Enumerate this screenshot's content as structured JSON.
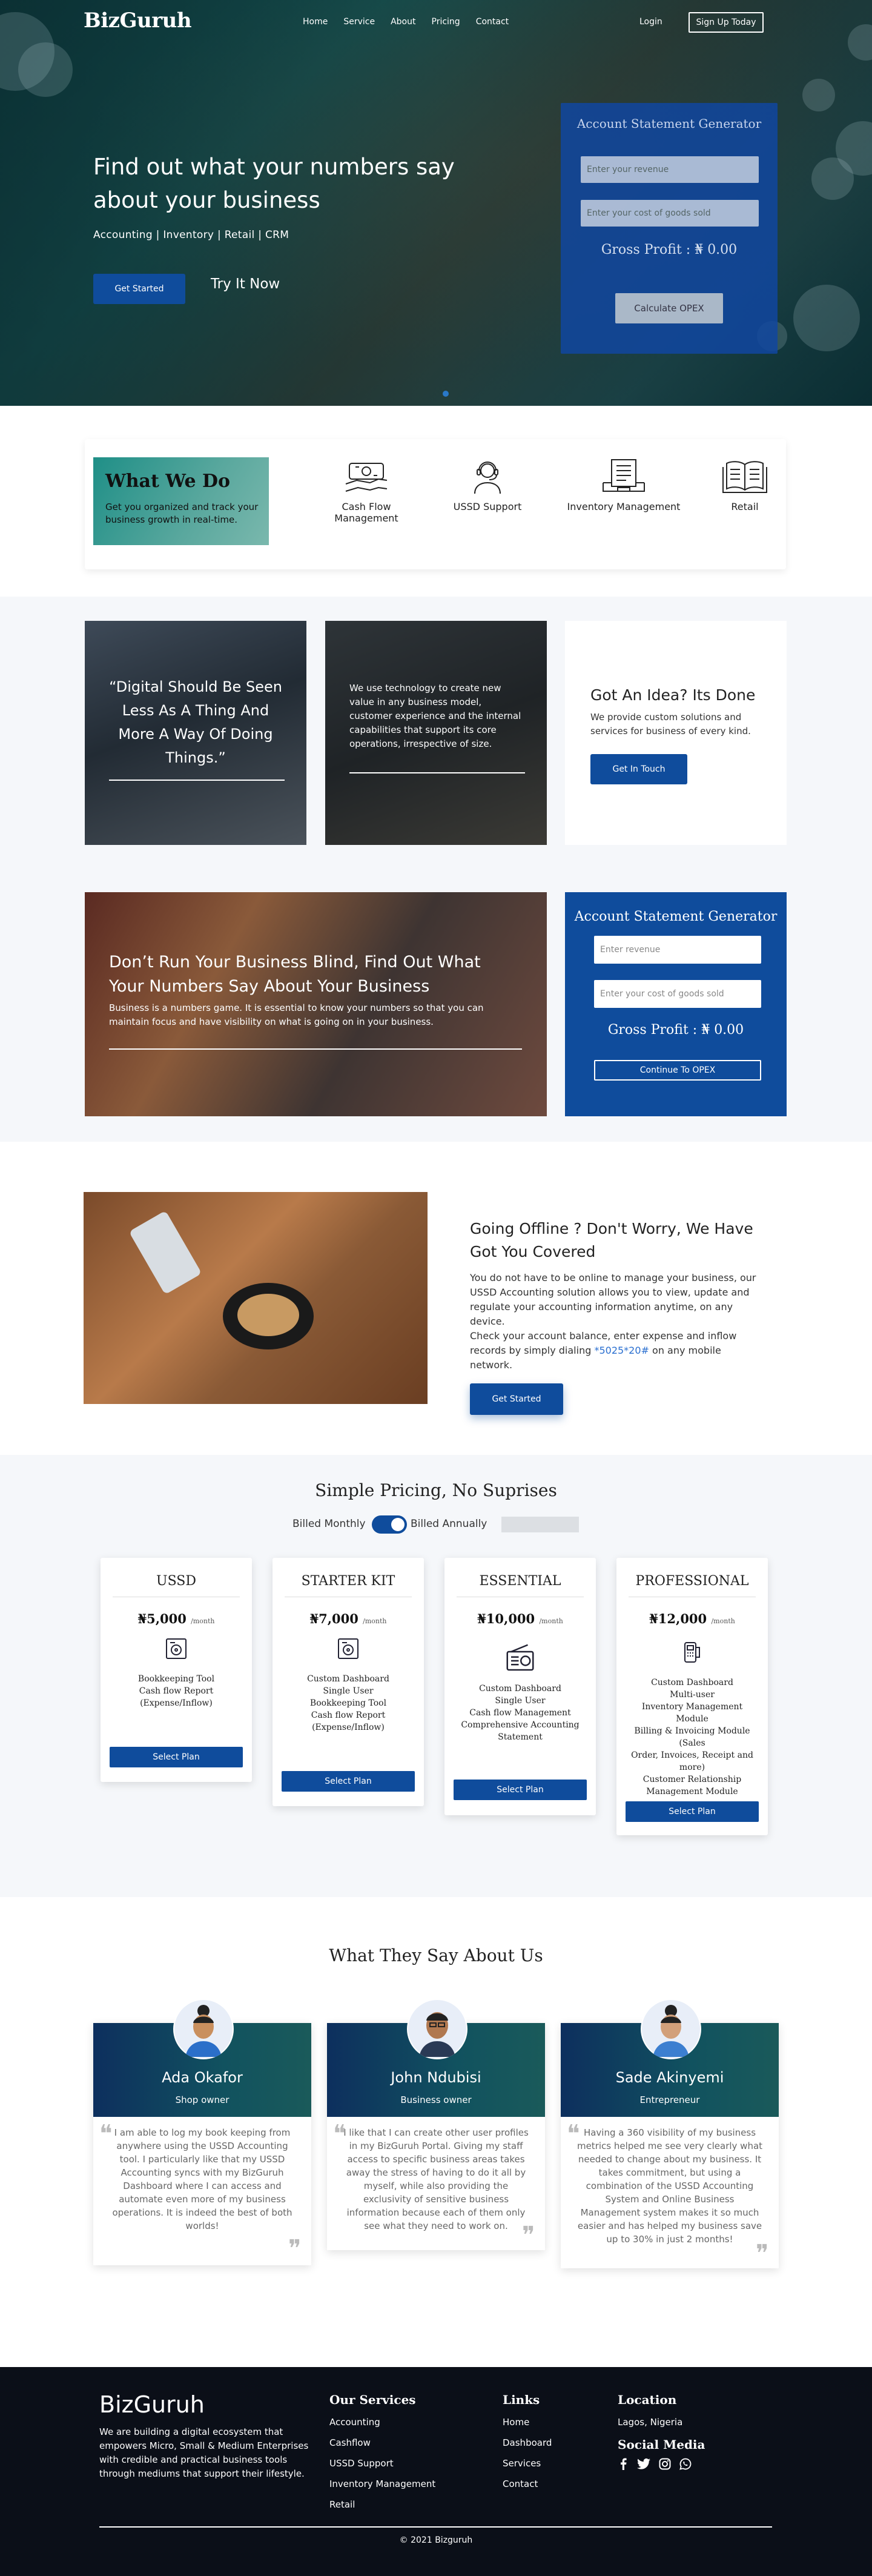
{
  "nav": {
    "logo": "BizGuruh",
    "links": [
      "Home",
      "Service",
      "About",
      "Pricing",
      "Contact"
    ],
    "login": "Login",
    "signup": "Sign Up Today"
  },
  "hero": {
    "title": "Find out what your numbers say about your business",
    "subtitle": "Accounting | Inventory | Retail | CRM",
    "cta": "Get Started",
    "secondary": "Try It Now"
  },
  "calculator": {
    "title": "Account Statement Generator",
    "revenue_placeholder": "Enter your revenue",
    "cogs_placeholder": "Enter your cost of goods sold",
    "gross_profit": "Gross Profit : ₦ 0.00",
    "button": "Calculate OPEX"
  },
  "whatwedo": {
    "title": "What We Do",
    "desc": "Get you organized and track your business growth in real-time.",
    "services": [
      {
        "label": "Cash Flow Management",
        "icon": "cash-icon"
      },
      {
        "label": "USSD Support",
        "icon": "support-agent-icon"
      },
      {
        "label": "Inventory Management",
        "icon": "inventory-icon"
      },
      {
        "label": "Retail",
        "icon": "book-icon"
      }
    ]
  },
  "cards": {
    "quote": "“Digital Should Be Seen Less As A Thing And More A Way Of Doing Things.”",
    "tech": "We use technology to create new value in any business model, customer experience and the internal capabilities that support its core operations, irrespective of size.",
    "idea_title": "Got An Idea? Its Done",
    "idea_desc": "We provide custom solutions and services for business of every kind.",
    "idea_button": "Get In Touch"
  },
  "blind": {
    "title": "Don’t Run Your Business Blind, Find Out What Your Numbers Say About Your Business",
    "desc": "Business is a numbers game. It is essential to know your numbers so that you can maintain focus and have visibility on what is going on in your business."
  },
  "calculator2": {
    "title": "Account Statement Generator",
    "revenue_placeholder": "Enter revenue",
    "cogs_placeholder": "Enter your cost of goods sold",
    "gross_profit": "Gross Profit : ₦ 0.00",
    "button": "Continue To OPEX"
  },
  "offline": {
    "title": "Going Offline ? Don't Worry, We Have Got You Covered",
    "p1": "You do not have to be online to manage your business, our USSD Accounting solution allows you to view, update and regulate your accounting information anytime, on any device.",
    "p2_pre": "Check your account balance, enter expense and inflow records by simply dialing ",
    "p2_code": "*5025*20#",
    "p2_post": " on any mobile network.",
    "button": "Get Started"
  },
  "pricing": {
    "title": "Simple Pricing, No Suprises",
    "monthly": "Billed Monthly",
    "annually": "Billed Annually",
    "select": "Select Plan",
    "plans": [
      {
        "name": "USSD",
        "price": "₦5,000",
        "period": "/month",
        "icon": "cash-register-icon",
        "features": [
          "Bookkeeping Tool",
          "Cash flow Report",
          "(Expense/Inflow)"
        ]
      },
      {
        "name": "STARTER KIT",
        "price": "₦7,000",
        "period": "/month",
        "icon": "cash-register-icon",
        "features": [
          "Custom Dashboard",
          "Single User",
          "Bookkeeping Tool",
          "Cash flow Report",
          "(Expense/Inflow)"
        ]
      },
      {
        "name": "ESSENTIAL",
        "price": "₦10,000",
        "period": "/month",
        "icon": "radio-icon",
        "features": [
          "Custom Dashboard",
          "Single User",
          "Cash flow Management",
          "Comprehensive Accounting",
          "Statement"
        ]
      },
      {
        "name": "PROFESSIONAL",
        "price": "₦12,000",
        "period": "/month",
        "icon": "pos-terminal-icon",
        "features": [
          "Custom Dashboard",
          "Multi-user",
          "Inventory Management Module",
          "Billing & Invoicing Module (Sales",
          "Order, Invoices, Receipt and more)",
          "Customer Relationship",
          "Management Module"
        ]
      }
    ]
  },
  "testimonials": {
    "title": "What They Say About Us",
    "items": [
      {
        "name": "Ada Okafor",
        "role": "Shop owner",
        "text": "I am able to log my book keeping from anywhere using the USSD Accounting tool. I particularly like that my USSD Accounting syncs with my BizGuruh Dashboard where I can access and automate even more of my business operations. It is indeed the best of both worlds!"
      },
      {
        "name": "John Ndubisi",
        "role": "Business owner",
        "text": "I like that I can create other user profiles in my BizGuruh Portal. Giving my staff access to specific business areas takes away the stress of having to do it all by myself, while also providing the exclusivity of sensitive business information because each of them only see what they need to work on."
      },
      {
        "name": "Sade Akinyemi",
        "role": "Entrepreneur",
        "text": "Having a 360 visibility of my business metrics helped me see very clearly what needed to change about my business. It takes commitment, but using a combination of the USSD Accounting System and Online Business Management system makes it so much easier and has helped my business save up to 30% in just 2 months!"
      }
    ]
  },
  "footer": {
    "logo": "BizGuruh",
    "desc": "We are building a digital ecosystem that empowers Micro, Small & Medium Enterprises with credible and practical business tools through mediums that support their lifestyle.",
    "services_title": "Our Services",
    "services": [
      "Accounting",
      "Cashflow",
      "USSD Support",
      "Inventory Management",
      "Retail"
    ],
    "links_title": "Links",
    "links": [
      "Home",
      "Dashboard",
      "Services",
      "Contact"
    ],
    "location_title": "Location",
    "location": "Lagos, Nigeria",
    "social_title": "Social Media",
    "copyright": "© 2021 Bizguruh"
  }
}
